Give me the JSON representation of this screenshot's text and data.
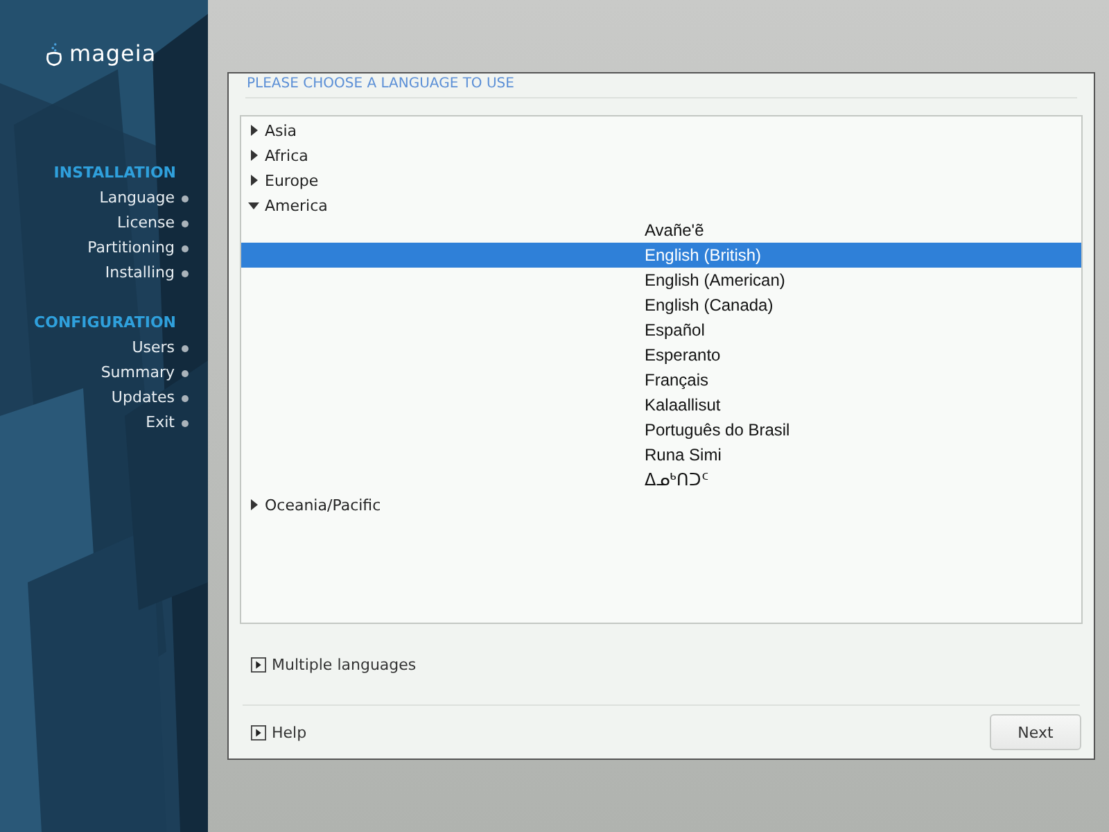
{
  "logo": {
    "text": "mageia"
  },
  "sidebar": {
    "sections": [
      {
        "title": "INSTALLATION",
        "items": [
          {
            "label": "Language"
          },
          {
            "label": "License"
          },
          {
            "label": "Partitioning"
          },
          {
            "label": "Installing"
          }
        ]
      },
      {
        "title": "CONFIGURATION",
        "items": [
          {
            "label": "Users"
          },
          {
            "label": "Summary"
          },
          {
            "label": "Updates"
          },
          {
            "label": "Exit"
          }
        ]
      }
    ]
  },
  "heading": "PLEASE CHOOSE A LANGUAGE TO USE",
  "tree": [
    {
      "label": "Asia",
      "expanded": false
    },
    {
      "label": "Africa",
      "expanded": false
    },
    {
      "label": "Europe",
      "expanded": false
    },
    {
      "label": "America",
      "expanded": true,
      "children": [
        {
          "label": "Avañe'ẽ",
          "selected": false
        },
        {
          "label": "English (British)",
          "selected": true
        },
        {
          "label": "English (American)",
          "selected": false
        },
        {
          "label": "English (Canada)",
          "selected": false
        },
        {
          "label": "Español",
          "selected": false
        },
        {
          "label": "Esperanto",
          "selected": false
        },
        {
          "label": "Français",
          "selected": false
        },
        {
          "label": "Kalaallisut",
          "selected": false
        },
        {
          "label": "Português do Brasil",
          "selected": false
        },
        {
          "label": "Runa Simi",
          "selected": false
        },
        {
          "label": "ᐃᓄᒃᑎᑐᑦ",
          "selected": false
        }
      ]
    },
    {
      "label": "Oceania/Pacific",
      "expanded": false
    }
  ],
  "expanders": [
    {
      "label": "Multiple languages",
      "expanded": false
    }
  ],
  "help": {
    "label": "Help",
    "expanded": false
  },
  "next_button": "Next"
}
